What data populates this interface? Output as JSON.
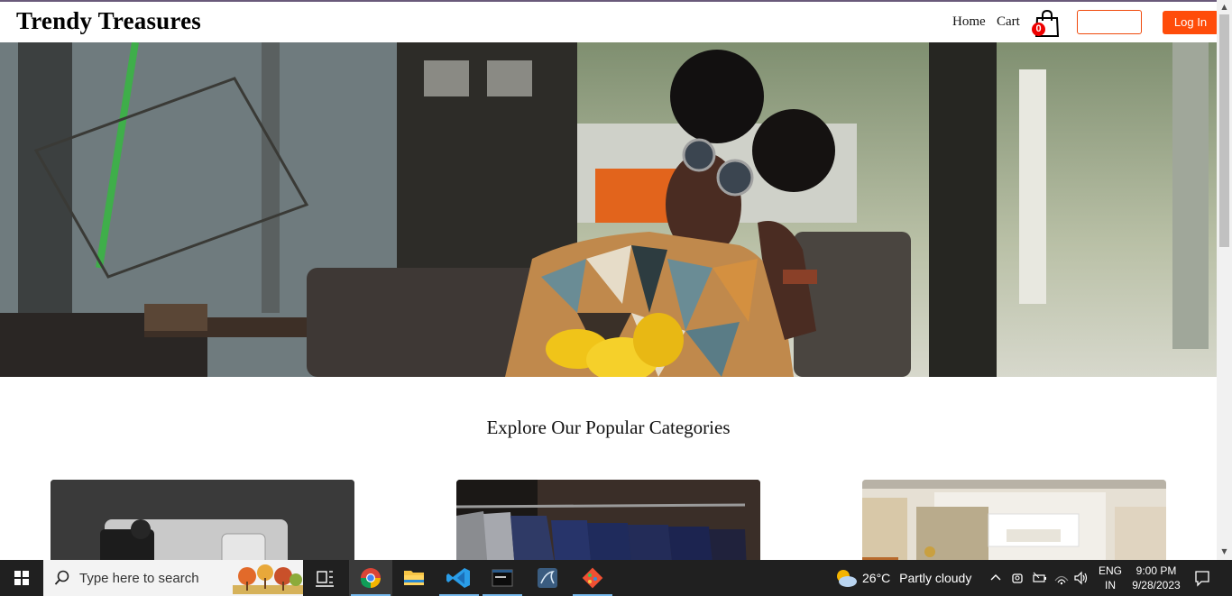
{
  "site": {
    "brand": "Trendy Treasures",
    "nav": {
      "home": "Home",
      "cart": "Cart"
    },
    "cart_count": "0",
    "login_label": "Log In",
    "accent_color": "#ff4c0a"
  },
  "categories": {
    "title": "Explore Our Popular Categories"
  },
  "taskbar": {
    "search_placeholder": "Type here to search",
    "weather": {
      "temperature": "26°C",
      "condition": "Partly cloudy"
    },
    "language": {
      "line1": "ENG",
      "line2": "IN"
    },
    "clock": {
      "time": "9:00 PM",
      "date": "9/28/2023"
    },
    "apps": [
      "windows-start-icon",
      "search-icon",
      "task-view-icon",
      "chrome-icon",
      "file-explorer-icon",
      "vscode-icon",
      "terminal-icon",
      "mysql-workbench-icon",
      "git-icon"
    ]
  }
}
